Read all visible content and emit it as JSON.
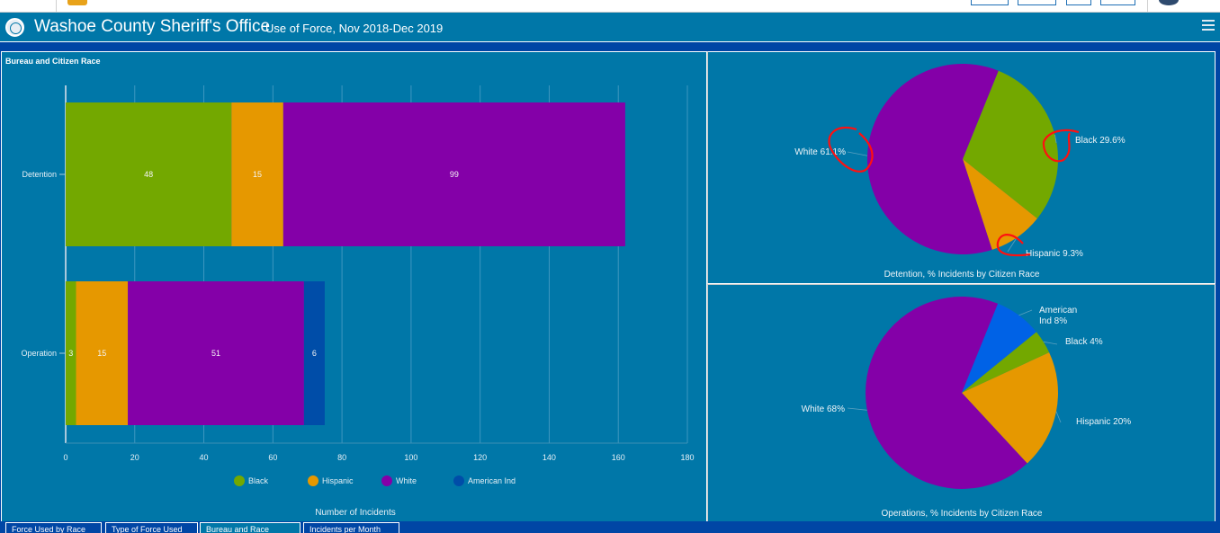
{
  "header": {
    "title": "Washoe County Sheriff's Office",
    "subtitle": "Use of Force, Nov 2018-Dec 2019",
    "menu_icon": "hamburger-menu-icon"
  },
  "colors": {
    "header_bg": "#0077a8",
    "band": "#0046a5",
    "black": "#73a800",
    "hispanic": "#e69800",
    "white": "#8400a8",
    "american_ind": "#004da8",
    "american_ind_pie": "#0062e6"
  },
  "left_panel": {
    "title": "Bureau and Citizen Race"
  },
  "tabs": [
    {
      "label": "Force Used by Race"
    },
    {
      "label": "Type of Force Used"
    },
    {
      "label": "Bureau and Race"
    },
    {
      "label": "Incidents per Month"
    }
  ],
  "chart_data": [
    {
      "type": "bar",
      "orientation": "horizontal",
      "stacked": true,
      "title": "Bureau and Citizen Race",
      "categories": [
        "Detention",
        "Operation"
      ],
      "series": [
        {
          "name": "Black",
          "values": [
            48,
            3
          ]
        },
        {
          "name": "Hispanic",
          "values": [
            15,
            15
          ]
        },
        {
          "name": "White",
          "values": [
            99,
            51
          ]
        },
        {
          "name": "American Ind",
          "values": [
            0,
            6
          ]
        }
      ],
      "xlabel": "Number of Incidents",
      "ylabel": "",
      "xlim": [
        0,
        180
      ],
      "xticks": [
        0,
        20,
        40,
        60,
        80,
        100,
        120,
        140,
        160,
        180
      ],
      "grid": true,
      "legend": "bottom"
    },
    {
      "type": "pie",
      "title": "Detention, % Incidents by Citizen Race",
      "slices": [
        {
          "name": "Black",
          "value": 29.6,
          "label": "Black 29.6%"
        },
        {
          "name": "Hispanic",
          "value": 9.3,
          "label": "Hispanic 9.3%"
        },
        {
          "name": "White",
          "value": 61.1,
          "label": "White 61.1%"
        }
      ]
    },
    {
      "type": "pie",
      "title": "Operations, % Incidents by Citizen Race",
      "slices": [
        {
          "name": "American Ind",
          "value": 8,
          "label": "American Ind 8%",
          "label_lines": [
            "American",
            "Ind 8%"
          ]
        },
        {
          "name": "Black",
          "value": 4,
          "label": "Black 4%"
        },
        {
          "name": "Hispanic",
          "value": 20,
          "label": "Hispanic 20%"
        },
        {
          "name": "White",
          "value": 68,
          "label": "White 68%"
        }
      ]
    }
  ]
}
